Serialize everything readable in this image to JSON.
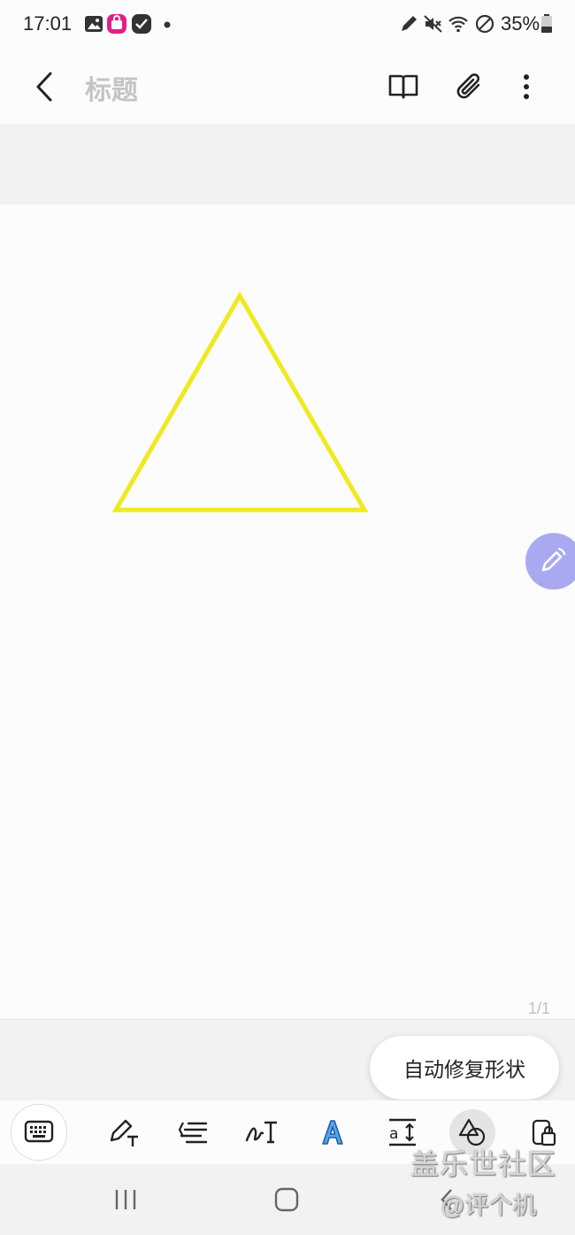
{
  "status_bar": {
    "time": "17:01",
    "battery": "35%",
    "left_icons": [
      "gallery-icon",
      "shop-icon",
      "check-app-icon",
      "dot-icon"
    ],
    "right_icons": [
      "pen-icon",
      "mute-icon",
      "wifi-icon",
      "no-disturb-icon",
      "battery-icon"
    ]
  },
  "app_bar": {
    "title_placeholder": "标题",
    "actions": [
      "book-icon",
      "attach-icon",
      "more-icon"
    ]
  },
  "canvas": {
    "shape": "triangle",
    "shape_color": "#f0e91f",
    "page_indicator": "1/1"
  },
  "toast": {
    "text": "自动修复形状"
  },
  "toolbar": {
    "tools": [
      "keyboard-icon",
      "pen-text-icon",
      "text-align-icon",
      "handwriting-icon",
      "text-style-icon",
      "text-size-icon",
      "shape-icon",
      "lock-icon"
    ]
  },
  "watermark": {
    "line1": "盖乐世社区",
    "line2": "@评个机"
  },
  "colors": {
    "accent_float": "#a9a9f2",
    "background": "#fcfcfc",
    "band": "#f2f2f2"
  }
}
